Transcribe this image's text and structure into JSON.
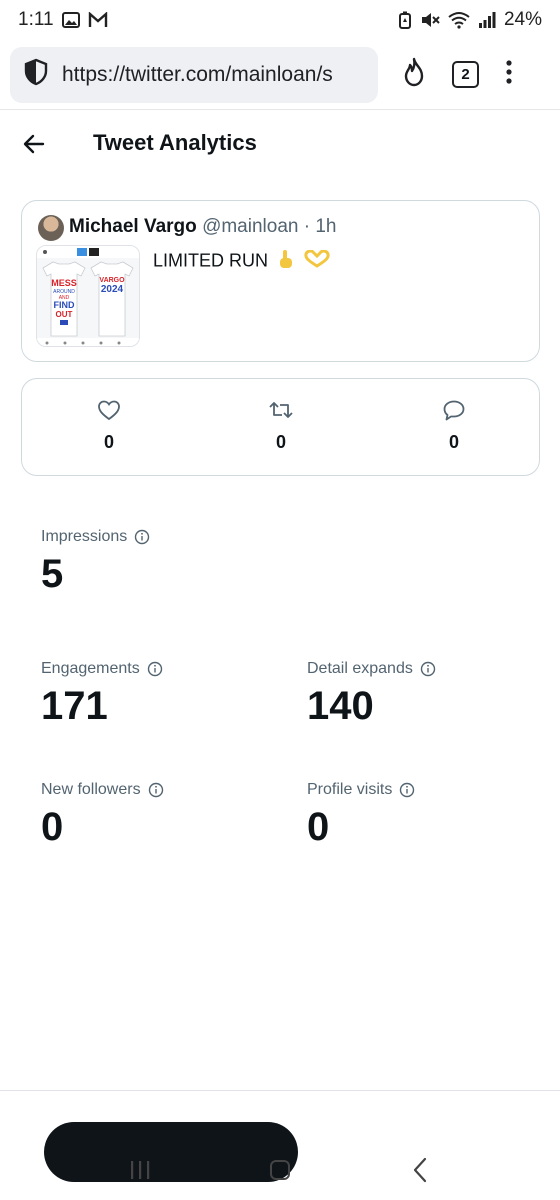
{
  "status_bar": {
    "time": "1:11",
    "battery": "24%"
  },
  "browser": {
    "url": "https://twitter.com/mainloan/s",
    "tab_count": "2"
  },
  "header": {
    "title": "Tweet Analytics"
  },
  "tweet": {
    "author_name": "Michael Vargo",
    "handle": "@mainloan",
    "separator": "·",
    "time": "1h",
    "text": "LIMITED RUN",
    "thumbnail": {
      "shirt1_lines": [
        "MESS",
        "AROUND",
        "AND",
        "FIND",
        "OUT"
      ],
      "shirt2_lines": [
        "VARGO",
        "2024"
      ]
    }
  },
  "engagement": {
    "likes": "0",
    "retweets": "0",
    "replies": "0"
  },
  "metrics": {
    "impressions_label": "Impressions",
    "impressions_value": "5",
    "engagements_label": "Engagements",
    "engagements_value": "171",
    "detail_expands_label": "Detail expands",
    "detail_expands_value": "140",
    "new_followers_label": "New followers",
    "new_followers_value": "0",
    "profile_visits_label": "Profile visits",
    "profile_visits_value": "0"
  },
  "colors": {
    "text_primary": "#0f1419",
    "text_secondary": "#536471",
    "border": "#cfd9de",
    "shirt_red": "#d8232a",
    "shirt_blue": "#2a4bb8"
  }
}
